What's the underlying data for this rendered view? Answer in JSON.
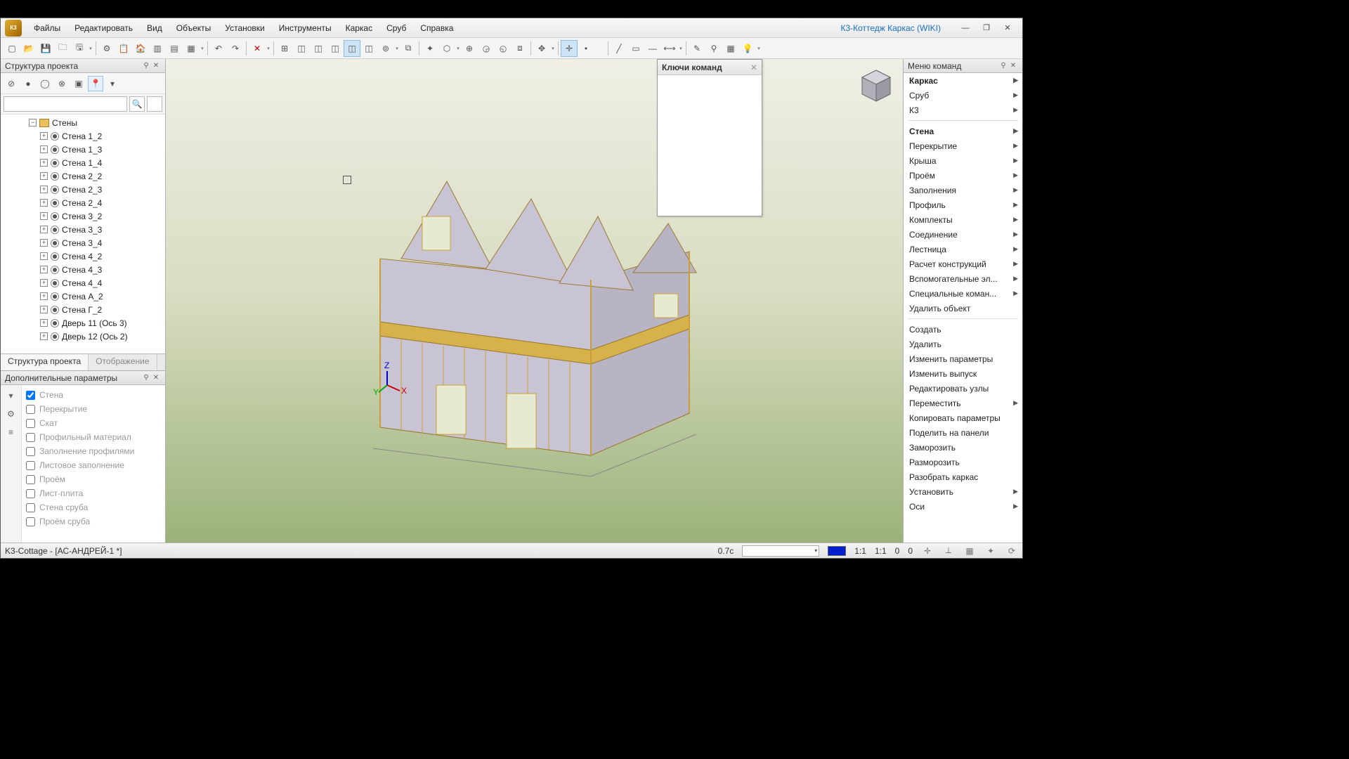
{
  "app": {
    "logo_text": "К3",
    "wiki_link": "К3-Коттедж Каркас (WIKI)",
    "title_doc": "K3-Cottage - [АС-АНДРЕЙ-1 *]"
  },
  "menubar": [
    "Файлы",
    "Редактировать",
    "Вид",
    "Объекты",
    "Установки",
    "Инструменты",
    "Каркас",
    "Сруб",
    "Справка"
  ],
  "panels": {
    "structure_title": "Структура проекта",
    "extra_title": "Дополнительные параметры",
    "cmd_keys_title": "Ключи команд",
    "cmd_menu_title": "Меню команд"
  },
  "left_tabs": {
    "active": "Структура проекта",
    "inactive": "Отображение"
  },
  "tree": {
    "parent": "Стены",
    "items": [
      "Стена 1_2",
      "Стена 1_3",
      "Стена 1_4",
      "Стена 2_2",
      "Стена 2_3",
      "Стена 2_4",
      "Стена 3_2",
      "Стена 3_3",
      "Стена 3_4",
      "Стена 4_2",
      "Стена 4_3",
      "Стена 4_4",
      "Стена А_2",
      "Стена Г_2",
      "Дверь 11 (Ось 3)",
      "Дверь 12 (Ось 2)"
    ]
  },
  "params": {
    "items": [
      {
        "label": "Стена",
        "checked": true
      },
      {
        "label": "Перекрытие",
        "checked": false
      },
      {
        "label": "Скат",
        "checked": false
      },
      {
        "label": "Профильный материал",
        "checked": false
      },
      {
        "label": "Заполнение профилями",
        "checked": false
      },
      {
        "label": "Листовое заполнение",
        "checked": false
      },
      {
        "label": "Проём",
        "checked": false
      },
      {
        "label": "Лист-плита",
        "checked": false
      },
      {
        "label": "Стена сруба",
        "checked": false
      },
      {
        "label": "Проём сруба",
        "checked": false
      }
    ]
  },
  "cmd_menu": {
    "top": [
      {
        "label": "Каркас",
        "bold": true,
        "sub": true
      },
      {
        "label": "Сруб",
        "bold": false,
        "sub": true
      },
      {
        "label": "К3",
        "bold": false,
        "sub": true
      }
    ],
    "group1": [
      {
        "label": "Стена",
        "bold": true,
        "sub": true
      },
      {
        "label": "Перекрытие",
        "sub": true
      },
      {
        "label": "Крыша",
        "sub": true
      },
      {
        "label": "Проём",
        "sub": true
      },
      {
        "label": "Заполнения",
        "sub": true
      },
      {
        "label": "Профиль",
        "sub": true
      },
      {
        "label": "Комплекты",
        "sub": true
      },
      {
        "label": "Соединение",
        "sub": true
      },
      {
        "label": "Лестница",
        "sub": true
      },
      {
        "label": "Расчет конструкций",
        "sub": true
      },
      {
        "label": "Вспомогательные эл...",
        "sub": true
      },
      {
        "label": "Специальные коман...",
        "sub": true
      },
      {
        "label": "Удалить объект",
        "sub": false
      }
    ],
    "group2": [
      {
        "label": "Создать"
      },
      {
        "label": "Удалить"
      },
      {
        "label": "Изменить параметры"
      },
      {
        "label": "Изменить выпуск"
      },
      {
        "label": "Редактировать узлы"
      },
      {
        "label": "Переместить",
        "sub": true
      },
      {
        "label": "Копировать параметры"
      },
      {
        "label": "Поделить на панели"
      },
      {
        "label": "Заморозить"
      },
      {
        "label": "Разморозить"
      },
      {
        "label": "Разобрать каркас"
      },
      {
        "label": "Установить",
        "sub": true
      },
      {
        "label": "Оси",
        "sub": true
      }
    ]
  },
  "status": {
    "doc": "K3-Cottage - [АС-АНДРЕЙ-1 *]",
    "time": "0.7с",
    "ratio1": "1:1",
    "ratio2": "1:1",
    "zero1": "0",
    "zero2": "0"
  },
  "search": {
    "placeholder": ""
  }
}
